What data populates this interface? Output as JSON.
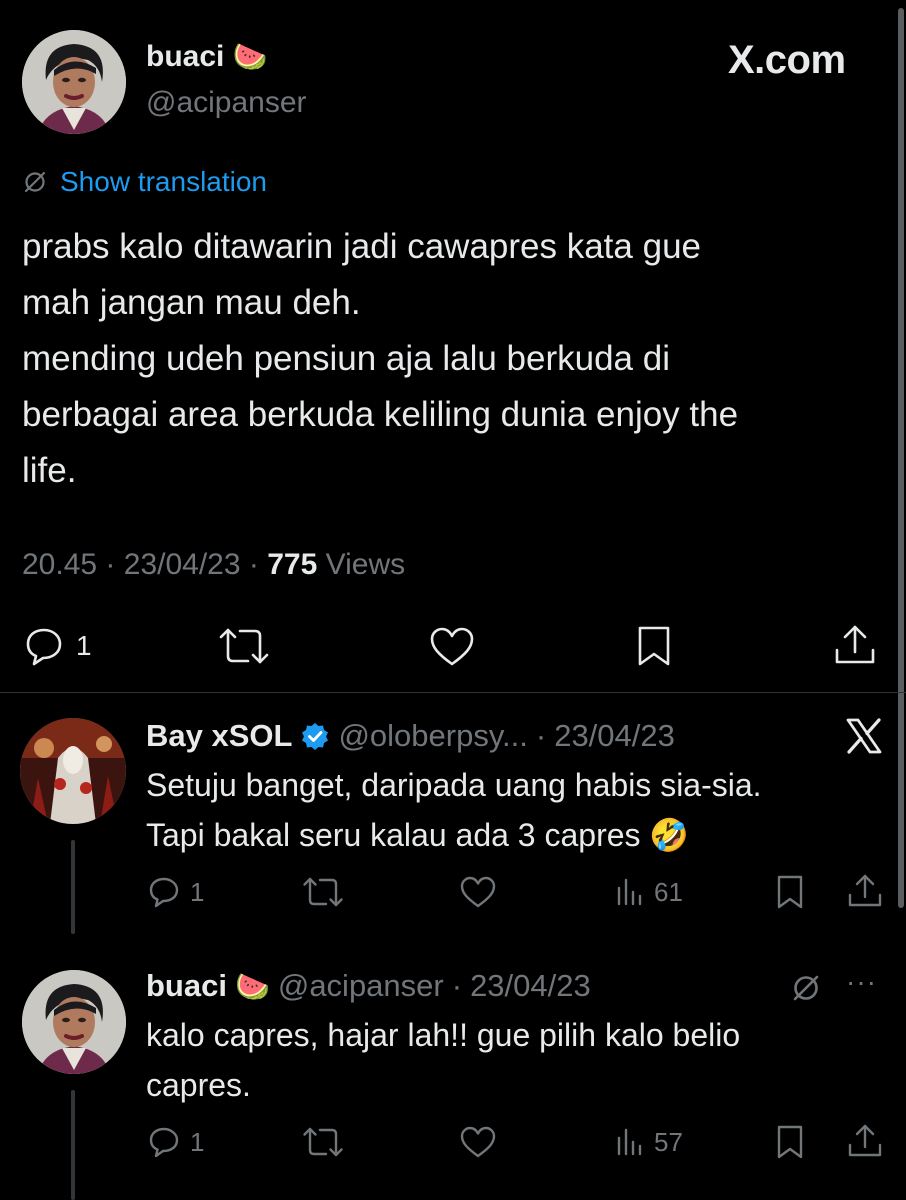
{
  "brand": {
    "logo_text": "X.com"
  },
  "main_tweet": {
    "display_name": "buaci",
    "name_emoji": "🍉",
    "handle": "@acipanser",
    "show_translation": "Show translation",
    "text_lines": [
      "prabs kalo ditawarin jadi cawapres kata gue",
      "mah jangan mau deh.",
      "mending udeh pensiun aja lalu berkuda di",
      "berbagai area berkuda keliling dunia enjoy the",
      "life."
    ],
    "time": "20.45",
    "date": "23/04/23",
    "views_count": "775",
    "views_label": "Views",
    "reply_count": "1"
  },
  "replies": [
    {
      "display_name": "Bay xSOL",
      "handle": "@oloberpsy...",
      "date": "23/04/23",
      "text_lines": [
        "Setuju banget, daripada uang habis sia-sia.",
        "Tapi bakal seru kalau ada 3 capres 🤣"
      ],
      "reply_count": "1",
      "views": "61"
    },
    {
      "display_name": "buaci",
      "name_emoji": "🍉",
      "handle": "@acipanser",
      "date": "23/04/23",
      "text_lines": [
        "kalo capres, hajar lah!! gue pilih kalo belio",
        "capres."
      ],
      "reply_count": "1",
      "views": "57",
      "more": "···"
    }
  ],
  "separator": "·",
  "colors": {
    "background": "#000000",
    "text": "#e7e9ea",
    "muted": "#71767b",
    "link": "#1d9bf0",
    "verified": "#1d9bf0",
    "divider": "#2f3336"
  }
}
